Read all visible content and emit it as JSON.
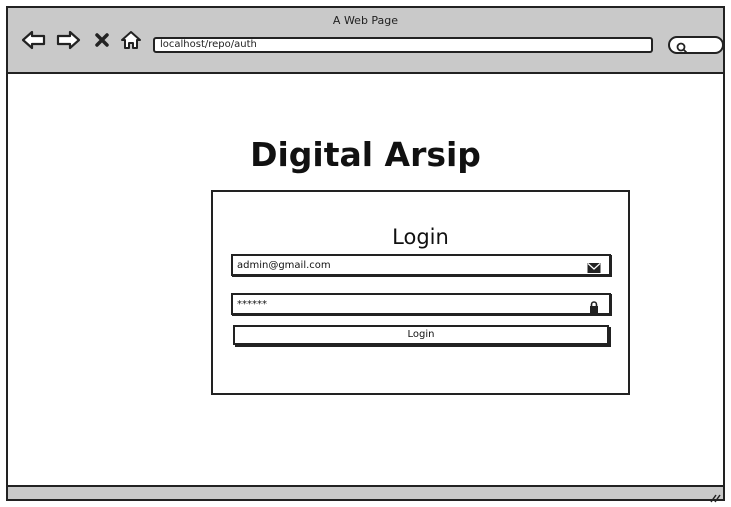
{
  "browser": {
    "window_title": "A Web Page",
    "address": "localhost/repo/auth",
    "icons": [
      "back-arrow-icon",
      "forward-arrow-icon",
      "close-icon",
      "home-icon",
      "search-icon"
    ]
  },
  "page": {
    "app_title": "Digital Arsip"
  },
  "login_form": {
    "heading": "Login",
    "email_value": "admin@gmail.com",
    "email_icon": "envelope-icon",
    "password_value": "******",
    "password_icon": "lock-icon",
    "submit_label": "Login"
  }
}
